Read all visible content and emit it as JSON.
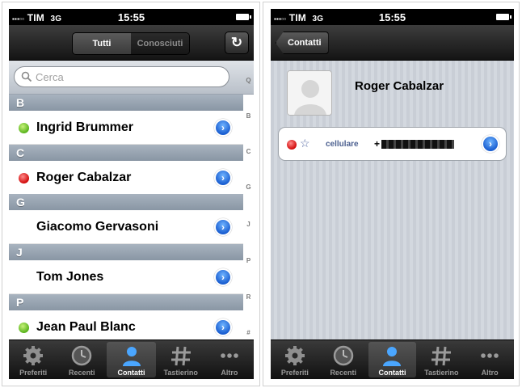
{
  "status": {
    "signal": "▪▪▪▫▫",
    "carrier": "TIM",
    "network": "3G",
    "time": "15:55"
  },
  "contacts_screen": {
    "segments": {
      "all": "Tutti",
      "known": "Conosciuti"
    },
    "refresh_icon": "refresh-icon",
    "search_placeholder": "Cerca",
    "sections": [
      {
        "letter": "B",
        "contacts": [
          {
            "name": "Ingrid Brummer",
            "presence": "online"
          }
        ]
      },
      {
        "letter": "C",
        "contacts": [
          {
            "name": "Roger Cabalzar",
            "presence": "busy"
          }
        ]
      },
      {
        "letter": "G",
        "contacts": [
          {
            "name": "Giacomo Gervasoni",
            "presence": "none"
          }
        ]
      },
      {
        "letter": "J",
        "contacts": [
          {
            "name": "Tom Jones",
            "presence": "none"
          }
        ]
      },
      {
        "letter": "P",
        "contacts": [
          {
            "name": "Jean Paul Blanc",
            "presence": "online"
          }
        ]
      }
    ],
    "index": [
      "Q",
      "B",
      "C",
      "G",
      "J",
      "P",
      "R",
      "#"
    ]
  },
  "detail_screen": {
    "back_label": "Contatti",
    "contact_name": "Roger Cabalzar",
    "phone_label": "cellulare",
    "phone_prefix": "+"
  },
  "tabbar": [
    {
      "label": "Preferiti",
      "icon": "gear-icon"
    },
    {
      "label": "Recenti",
      "icon": "clock-icon"
    },
    {
      "label": "Contatti",
      "icon": "person-icon",
      "active": true
    },
    {
      "label": "Tastierino",
      "icon": "keypad-icon"
    },
    {
      "label": "Altro",
      "icon": "more-icon"
    }
  ],
  "colors": {
    "presence_online": "#58b31c",
    "presence_busy": "#d10a0a",
    "accent_blue": "#1b5fd1"
  }
}
